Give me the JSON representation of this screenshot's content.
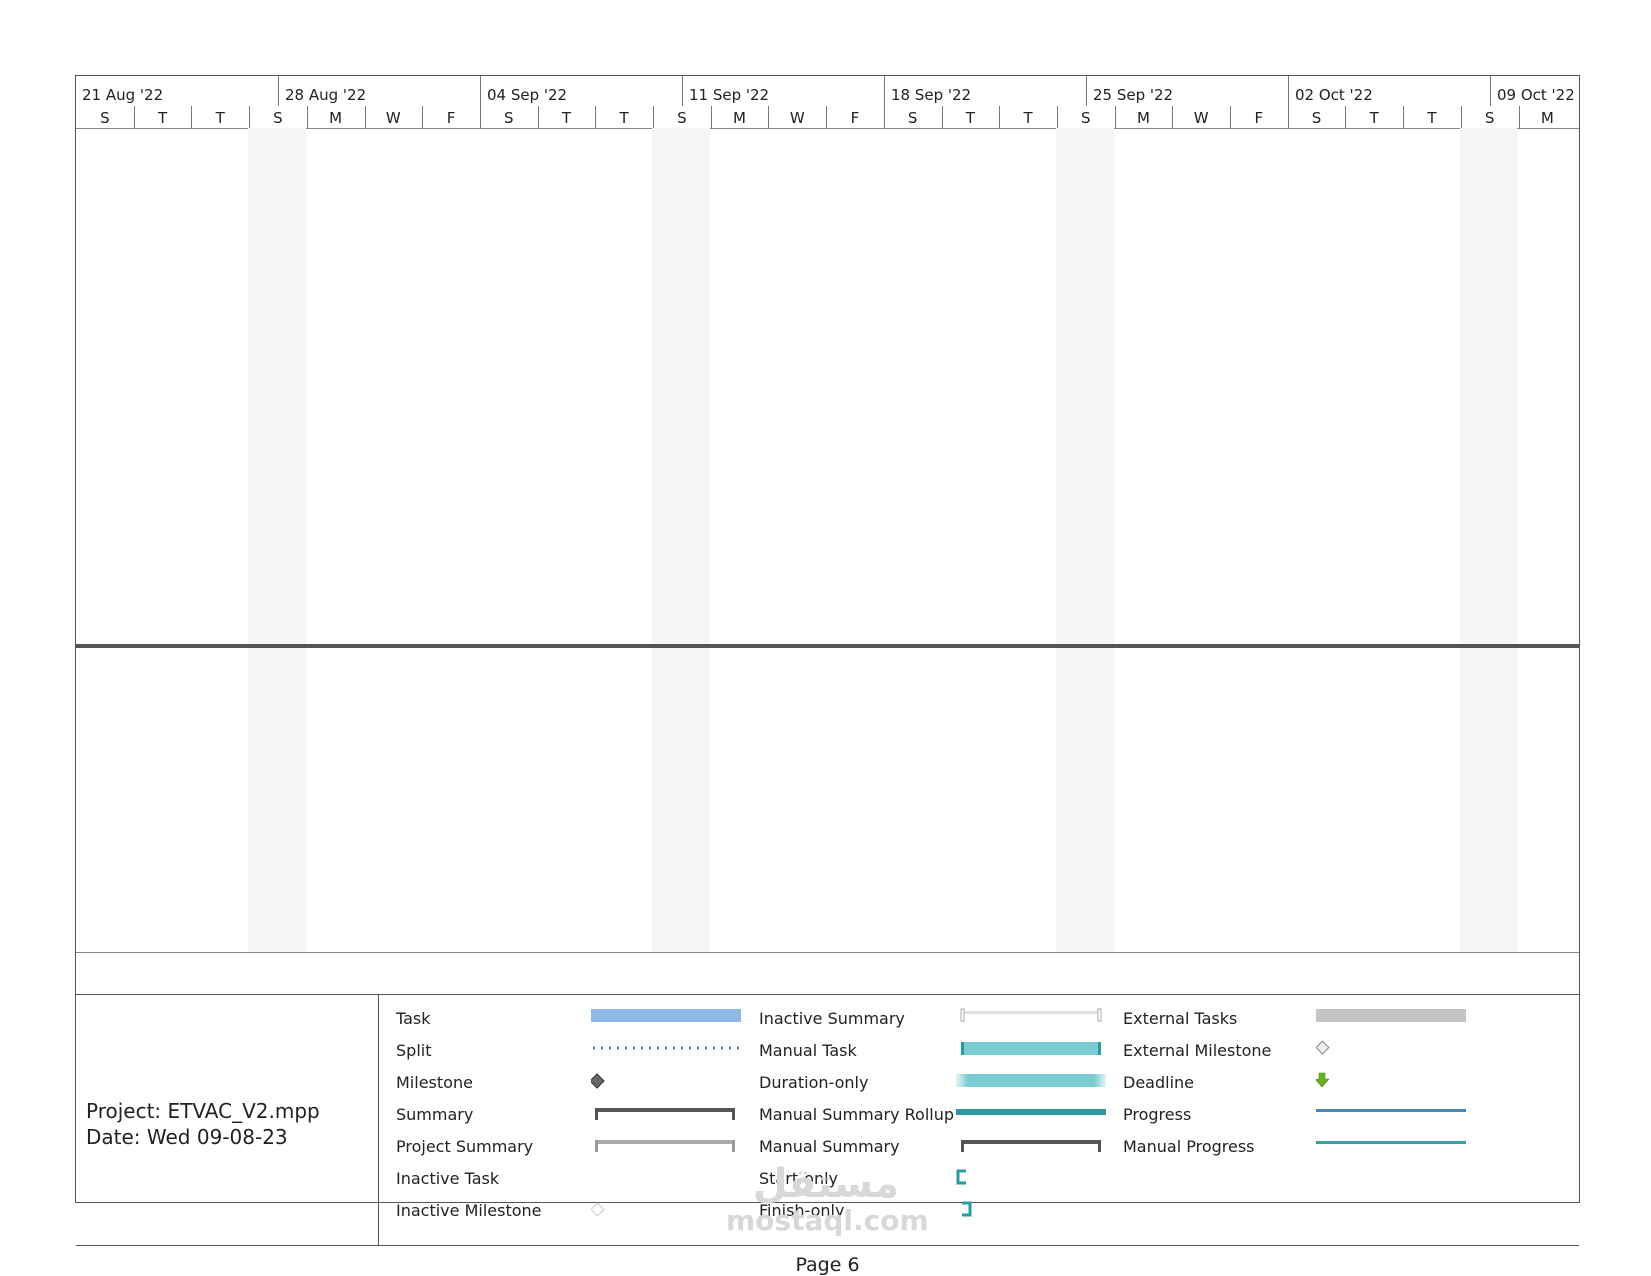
{
  "timescale": {
    "weeks": [
      "21 Aug '22",
      "28 Aug '22",
      "04 Sep '22",
      "11 Sep '22",
      "18 Sep '22",
      "25 Sep '22",
      "02 Oct '22",
      "09 Oct '22"
    ],
    "days": [
      "S",
      "T",
      "T",
      "S",
      "M",
      "W",
      "F",
      "S",
      "T",
      "T",
      "S",
      "M",
      "W",
      "F",
      "S",
      "T",
      "T",
      "S",
      "M",
      "W",
      "F",
      "S",
      "T",
      "T",
      "S",
      "M"
    ]
  },
  "project": {
    "project_line": "Project: ETVAC_V2.mpp",
    "date_line": "Date: Wed 09-08-23"
  },
  "legend": {
    "col1": [
      {
        "label": "Task",
        "symbol": "task-bar"
      },
      {
        "label": "Split",
        "symbol": "split-dots"
      },
      {
        "label": "Milestone",
        "symbol": "milestone-diamond"
      },
      {
        "label": "Summary",
        "symbol": "summary-bracket"
      },
      {
        "label": "Project Summary",
        "symbol": "project-summary-bracket"
      },
      {
        "label": "Inactive Task",
        "symbol": "none"
      },
      {
        "label": "Inactive Milestone",
        "symbol": "inactive-milestone-diamond"
      }
    ],
    "col2": [
      {
        "label": "Inactive Summary",
        "symbol": "inactive-summary-bracket"
      },
      {
        "label": "Manual Task",
        "symbol": "manual-task-bar"
      },
      {
        "label": "Duration-only",
        "symbol": "duration-only-bar"
      },
      {
        "label": "Manual Summary Rollup",
        "symbol": "manual-summary-rollup-bar"
      },
      {
        "label": "Manual Summary",
        "symbol": "manual-summary-bracket"
      },
      {
        "label": "Start-only",
        "symbol": "start-only-bracket"
      },
      {
        "label": "Finish-only",
        "symbol": "finish-only-bracket"
      }
    ],
    "col3": [
      {
        "label": "External Tasks",
        "symbol": "external-task-bar"
      },
      {
        "label": "External Milestone",
        "symbol": "external-milestone-diamond"
      },
      {
        "label": "Deadline",
        "symbol": "deadline-arrow"
      },
      {
        "label": "Progress",
        "symbol": "progress-line"
      },
      {
        "label": "Manual Progress",
        "symbol": "manual-progress-line"
      }
    ]
  },
  "colors": {
    "task": "#8db8e8",
    "manual_task": "#7accd0",
    "manual_accent": "#2a9aa0",
    "summary": "#555555",
    "project_summary": "#aaaaaa",
    "external": "#c4c4c4",
    "progress": "#3f88b8",
    "manual_progress": "#3aa0a8",
    "deadline": "#6ab02a"
  },
  "footer": {
    "page_label": "Page 6"
  },
  "watermark": {
    "arabic": "مستقل",
    "latin": "mostaql.com"
  }
}
